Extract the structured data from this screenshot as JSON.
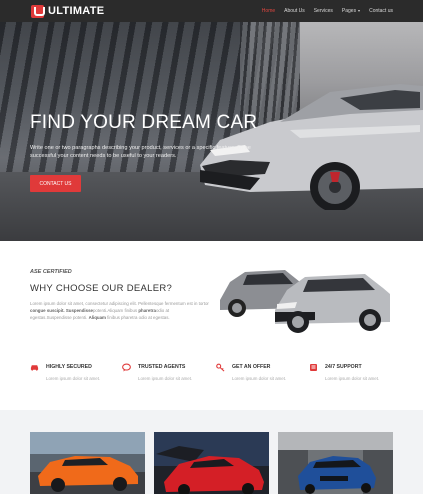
{
  "nav": {
    "brand": "ULTIMATE",
    "links": [
      {
        "label": "Home",
        "active": true
      },
      {
        "label": "About Us"
      },
      {
        "label": "Services"
      },
      {
        "label": "Pages"
      },
      {
        "label": "Contact us"
      }
    ]
  },
  "hero": {
    "title": "FIND YOUR DREAM CAR",
    "text": "Write one or two paragraphs describing your product, services or a specific feature. To be successful your content needs to be useful to your readers.",
    "button": "CONTACT US"
  },
  "dealer": {
    "eyebrow": "ASE CERTIFIED",
    "title": "WHY CHOOSE OUR DEALER?",
    "text_1": "Lorem ipsum dolor sit amet, consectetur adipiscing elit. Pellentesque fermentum est in tortor ",
    "bold_1": "congue suscipit. Suspendisse",
    "text_2": "potenti.Aliquam finibus ",
    "bold_2": "pharetra",
    "text_3": "odio at egestas.Suspendisse potenti. ",
    "bold_3": "Aliquam",
    "text_4": " finibus pharetra odio at egestas."
  },
  "features": [
    {
      "icon": "car-icon",
      "title": "HIGHLY SECURED",
      "text": "Lorem ipsum dolor sit amet."
    },
    {
      "icon": "chat-icon",
      "title": "TRUSTED AGENTS",
      "text": "Lorem ipsum dolor sit amet."
    },
    {
      "icon": "key-icon",
      "title": "GET AN OFFER",
      "text": "Lorem ipsum dolor sit amet."
    },
    {
      "icon": "book-icon",
      "title": "24/7 SUPPORT",
      "text": "Lorem ipsum dolor sit amet."
    }
  ],
  "colors": {
    "accent": "#e03a3a",
    "navbar": "#2b2b2b",
    "gallery_bg": "#f2f3f5"
  }
}
